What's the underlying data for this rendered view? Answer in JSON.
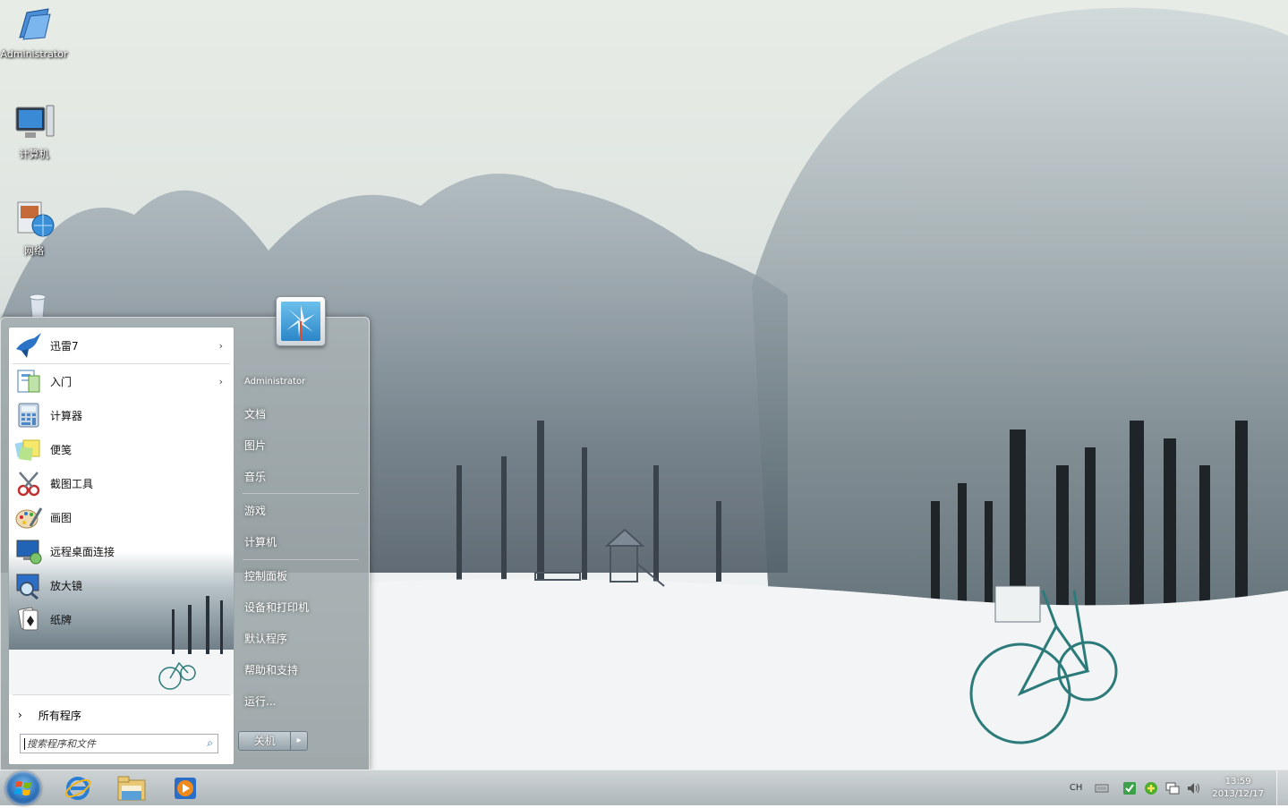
{
  "desktop": {
    "icons": [
      {
        "label": "Administrator",
        "icon": "user-folder-icon"
      },
      {
        "label": "计算机",
        "icon": "computer-icon"
      },
      {
        "label": "网络",
        "icon": "network-icon"
      },
      {
        "label": "",
        "icon": "recycle-bin-icon"
      }
    ]
  },
  "start_menu": {
    "pinned": [
      {
        "label": "迅雷7",
        "icon": "thunder-bird-icon",
        "has_submenu": true
      }
    ],
    "recent": [
      {
        "label": "入门",
        "icon": "getting-started-icon",
        "has_submenu": true
      },
      {
        "label": "计算器",
        "icon": "calculator-icon",
        "has_submenu": false
      },
      {
        "label": "便笺",
        "icon": "sticky-notes-icon",
        "has_submenu": false
      },
      {
        "label": "截图工具",
        "icon": "snipping-tool-icon",
        "has_submenu": false
      },
      {
        "label": "画图",
        "icon": "paint-icon",
        "has_submenu": false
      },
      {
        "label": "远程桌面连接",
        "icon": "remote-desktop-icon",
        "has_submenu": false
      },
      {
        "label": "放大镜",
        "icon": "magnifier-icon",
        "has_submenu": false
      },
      {
        "label": "纸牌",
        "icon": "solitaire-icon",
        "has_submenu": false
      }
    ],
    "all_programs": "所有程序",
    "search_placeholder": "搜索程序和文件",
    "user_name": "Administrator",
    "right_links": {
      "documents": "文档",
      "pictures": "图片",
      "music": "音乐",
      "games": "游戏",
      "computer": "计算机",
      "control_panel": "控制面板",
      "devices_printers": "设备和打印机",
      "default_programs": "默认程序",
      "help_support": "帮助和支持",
      "run": "运行..."
    },
    "shutdown_label": "关机"
  },
  "taskbar": {
    "pinned": [
      {
        "name": "ie-icon"
      },
      {
        "name": "explorer-icon"
      },
      {
        "name": "media-player-icon"
      }
    ],
    "tray": {
      "language": "CH",
      "time": "13:59",
      "date": "2013/12/17"
    }
  }
}
